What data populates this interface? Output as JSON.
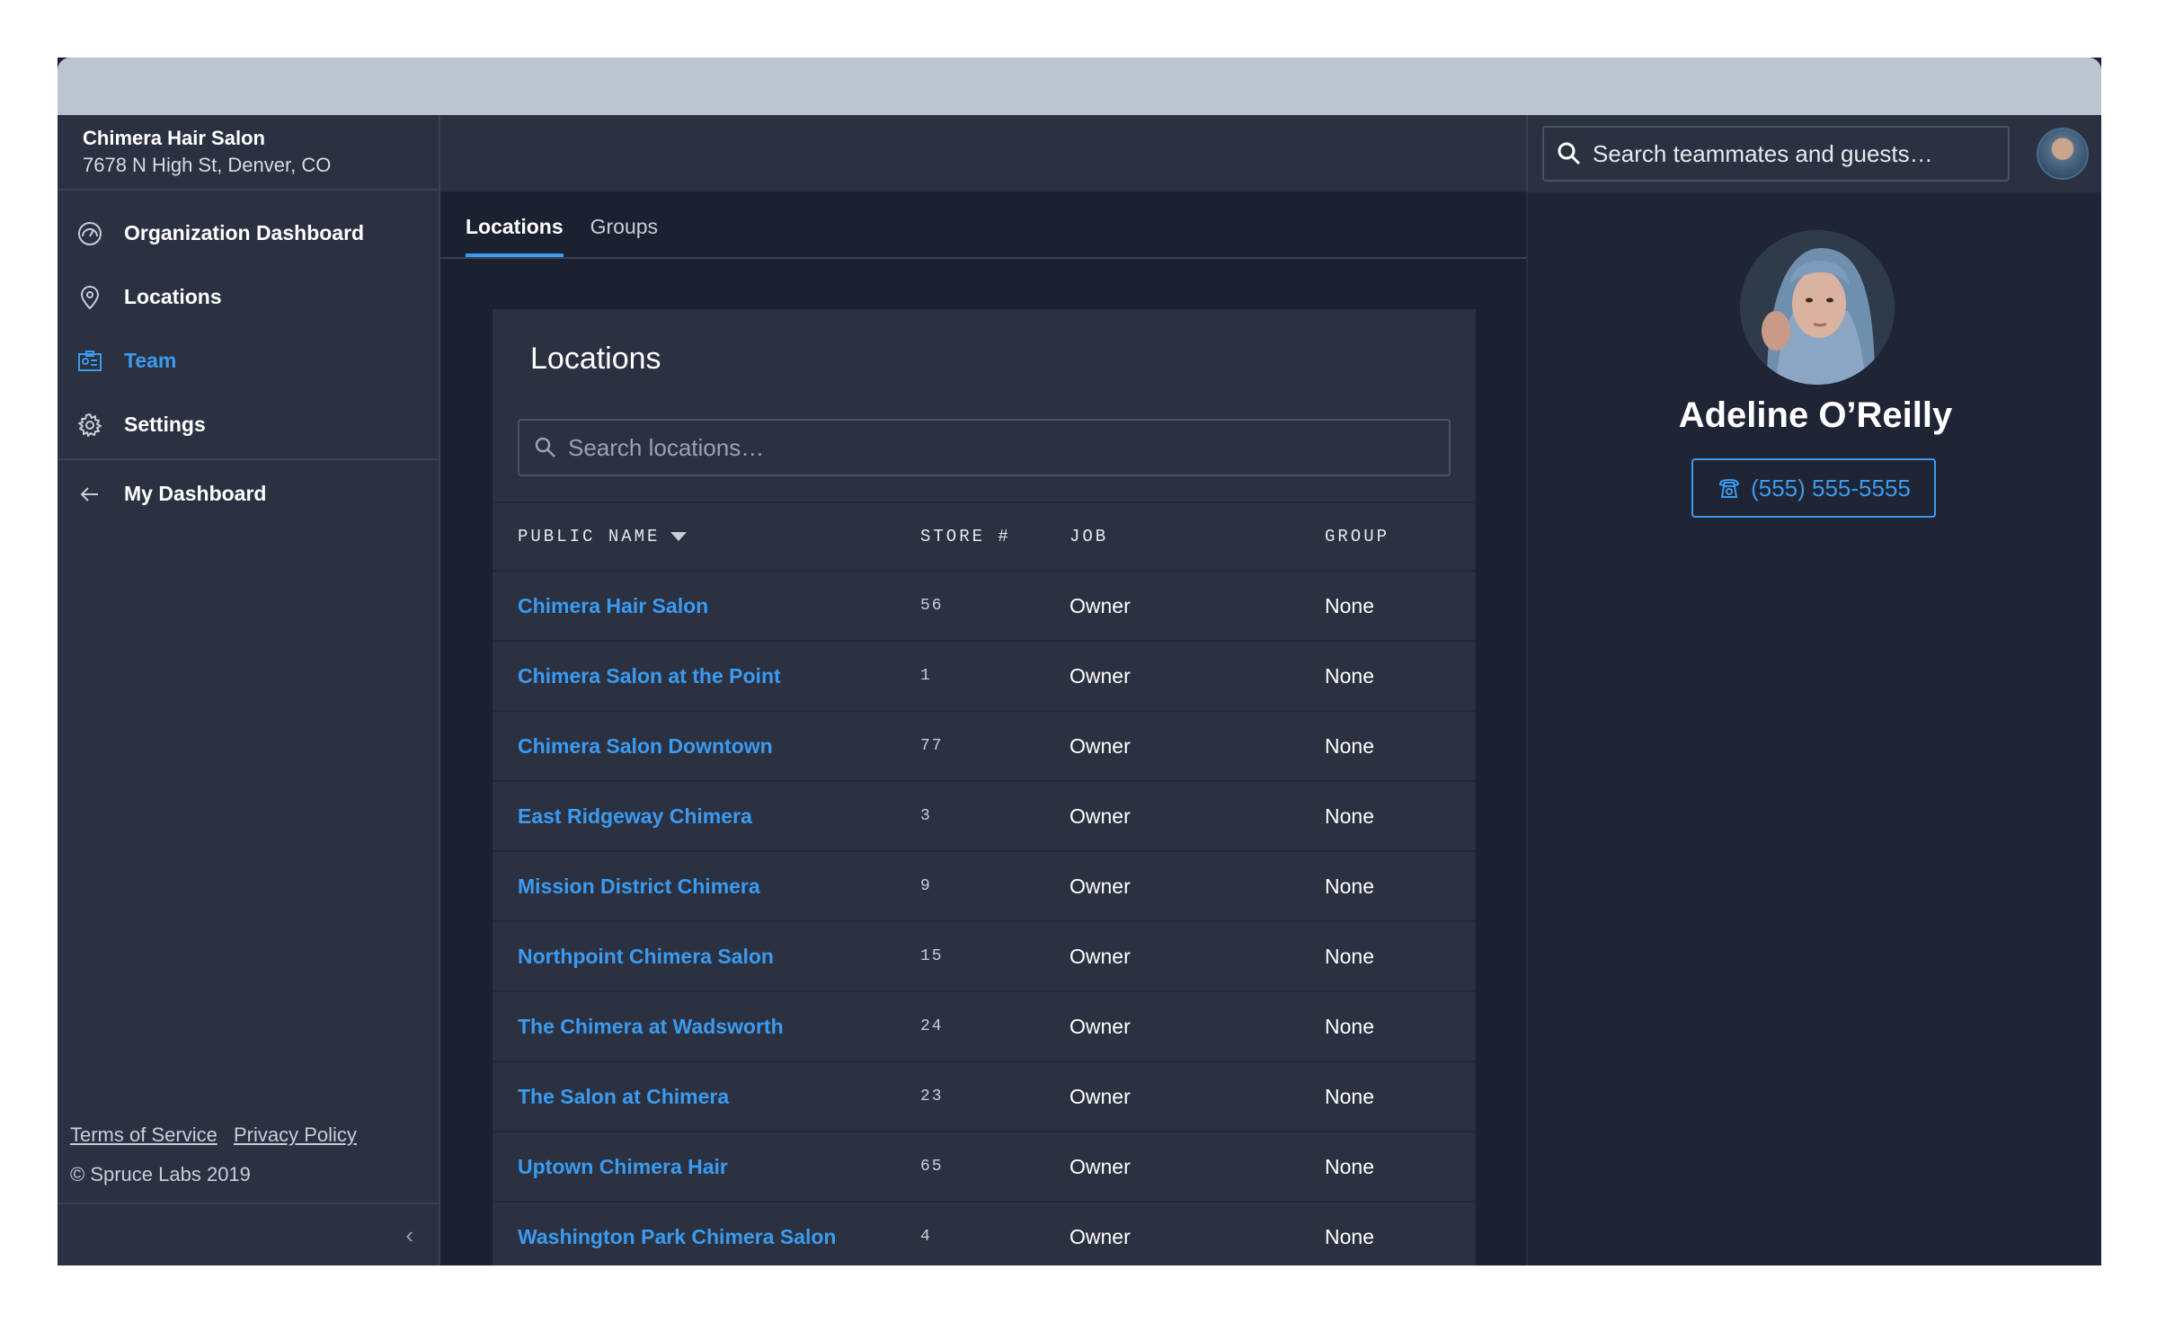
{
  "sidebar": {
    "org_name": "Chimera Hair Salon",
    "org_address": "7678 N High St, Denver, CO",
    "nav": [
      {
        "label": "Organization Dashboard",
        "icon": "dashboard-icon"
      },
      {
        "label": "Locations",
        "icon": "location-pin-icon"
      },
      {
        "label": "Team",
        "icon": "team-id-card-icon",
        "active": true
      },
      {
        "label": "Settings",
        "icon": "gear-icon"
      }
    ],
    "back_item": {
      "label": "My Dashboard",
      "icon": "arrow-left-icon"
    },
    "footer": {
      "terms": "Terms of Service",
      "privacy": "Privacy Policy",
      "copyright": "© Spruce Labs 2019"
    },
    "collapse_icon": "chevron-left-icon"
  },
  "topbar": {
    "search_placeholder": "Search teammates and guests…"
  },
  "main": {
    "tabs": [
      {
        "label": "Locations",
        "active": true
      },
      {
        "label": "Groups"
      }
    ],
    "card_title": "Locations",
    "search_placeholder": "Search locations…",
    "columns": [
      "PUBLIC NAME",
      "STORE #",
      "JOB",
      "GROUP"
    ],
    "rows": [
      {
        "name": "Chimera Hair Salon",
        "store": "56",
        "job": "Owner",
        "group": "None"
      },
      {
        "name": "Chimera Salon at the Point",
        "store": "1",
        "job": "Owner",
        "group": "None"
      },
      {
        "name": "Chimera Salon Downtown",
        "store": "77",
        "job": "Owner",
        "group": "None"
      },
      {
        "name": "East Ridgeway Chimera",
        "store": "3",
        "job": "Owner",
        "group": "None"
      },
      {
        "name": "Mission District Chimera",
        "store": "9",
        "job": "Owner",
        "group": "None"
      },
      {
        "name": "Northpoint Chimera Salon",
        "store": "15",
        "job": "Owner",
        "group": "None"
      },
      {
        "name": "The Chimera at Wadsworth",
        "store": "24",
        "job": "Owner",
        "group": "None"
      },
      {
        "name": "The Salon at Chimera",
        "store": "23",
        "job": "Owner",
        "group": "None"
      },
      {
        "name": "Uptown Chimera Hair",
        "store": "65",
        "job": "Owner",
        "group": "None"
      },
      {
        "name": "Washington Park Chimera Salon",
        "store": "4",
        "job": "Owner",
        "group": "None"
      }
    ]
  },
  "profile": {
    "name": "Adeline O’Reilly",
    "phone": "(555) 555-5555"
  },
  "colors": {
    "accent": "#3a9bf0",
    "sidebar_bg": "#2b3141",
    "main_bg": "#1b2130"
  }
}
